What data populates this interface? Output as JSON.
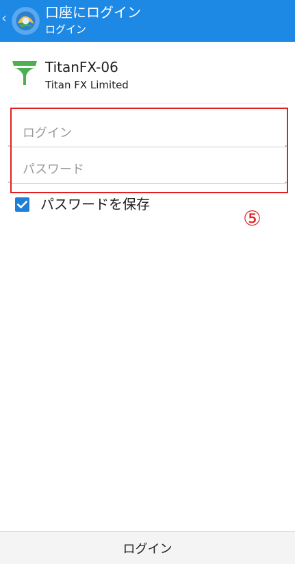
{
  "header": {
    "title": "口座にログイン",
    "subtitle": "ログイン"
  },
  "server": {
    "name": "TitanFX-06",
    "company": "Titan FX Limited",
    "logo_color": "#4caf50"
  },
  "form": {
    "login_placeholder": "ログイン",
    "password_placeholder": "パスワード",
    "save_password_label": "パスワードを保存",
    "save_password_checked": true
  },
  "annotation": {
    "step_number": "⑤",
    "color": "#e02020"
  },
  "footer": {
    "login_button": "ログイン"
  },
  "colors": {
    "accent": "#1e88e5"
  }
}
